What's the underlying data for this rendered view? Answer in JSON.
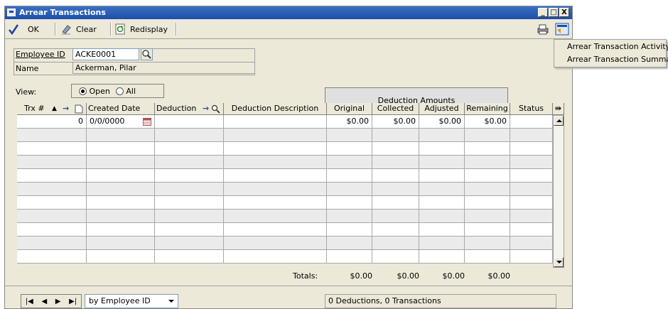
{
  "window": {
    "title": "Arrear Transactions",
    "controls": [
      "_",
      "□",
      "X"
    ]
  },
  "toolbar": {
    "ok_label": "OK",
    "clear_label": "Clear",
    "redisplay_label": "Redisplay"
  },
  "employee": {
    "id_label": "Employee ID",
    "id_value": "ACKE0001",
    "name_label": "Name",
    "name_value": "Ackerman, Pilar"
  },
  "view": {
    "label": "View:",
    "options": [
      "Open",
      "All"
    ],
    "selected": "Open"
  },
  "grid": {
    "group_header": "Deduction Amounts",
    "columns": [
      "Trx #",
      "Created Date",
      "Deduction",
      "Deduction Description",
      "Original",
      "Collected",
      "Adjusted",
      "Remaining",
      "Status"
    ],
    "rows": [
      {
        "trx": "0",
        "date": "0/0/0000",
        "deduction": "",
        "description": "",
        "original": "$0.00",
        "collected": "$0.00",
        "adjusted": "$0.00",
        "remaining": "$0.00",
        "status": ""
      }
    ],
    "totals_label": "Totals:",
    "totals": {
      "original": "$0.00",
      "collected": "$0.00",
      "adjusted": "$0.00",
      "remaining": "$0.00"
    }
  },
  "footer": {
    "sort_value": "by Employee ID",
    "status_text": "0 Deductions, 0 Transactions"
  },
  "popup_menu": {
    "items": [
      "Arrear Transaction Activity",
      "Arrear Transaction Summary"
    ]
  },
  "colors": {
    "titlebar": "#1c4fa8",
    "window_bg": "#ece9d8",
    "alt_row": "#ebebeb"
  }
}
